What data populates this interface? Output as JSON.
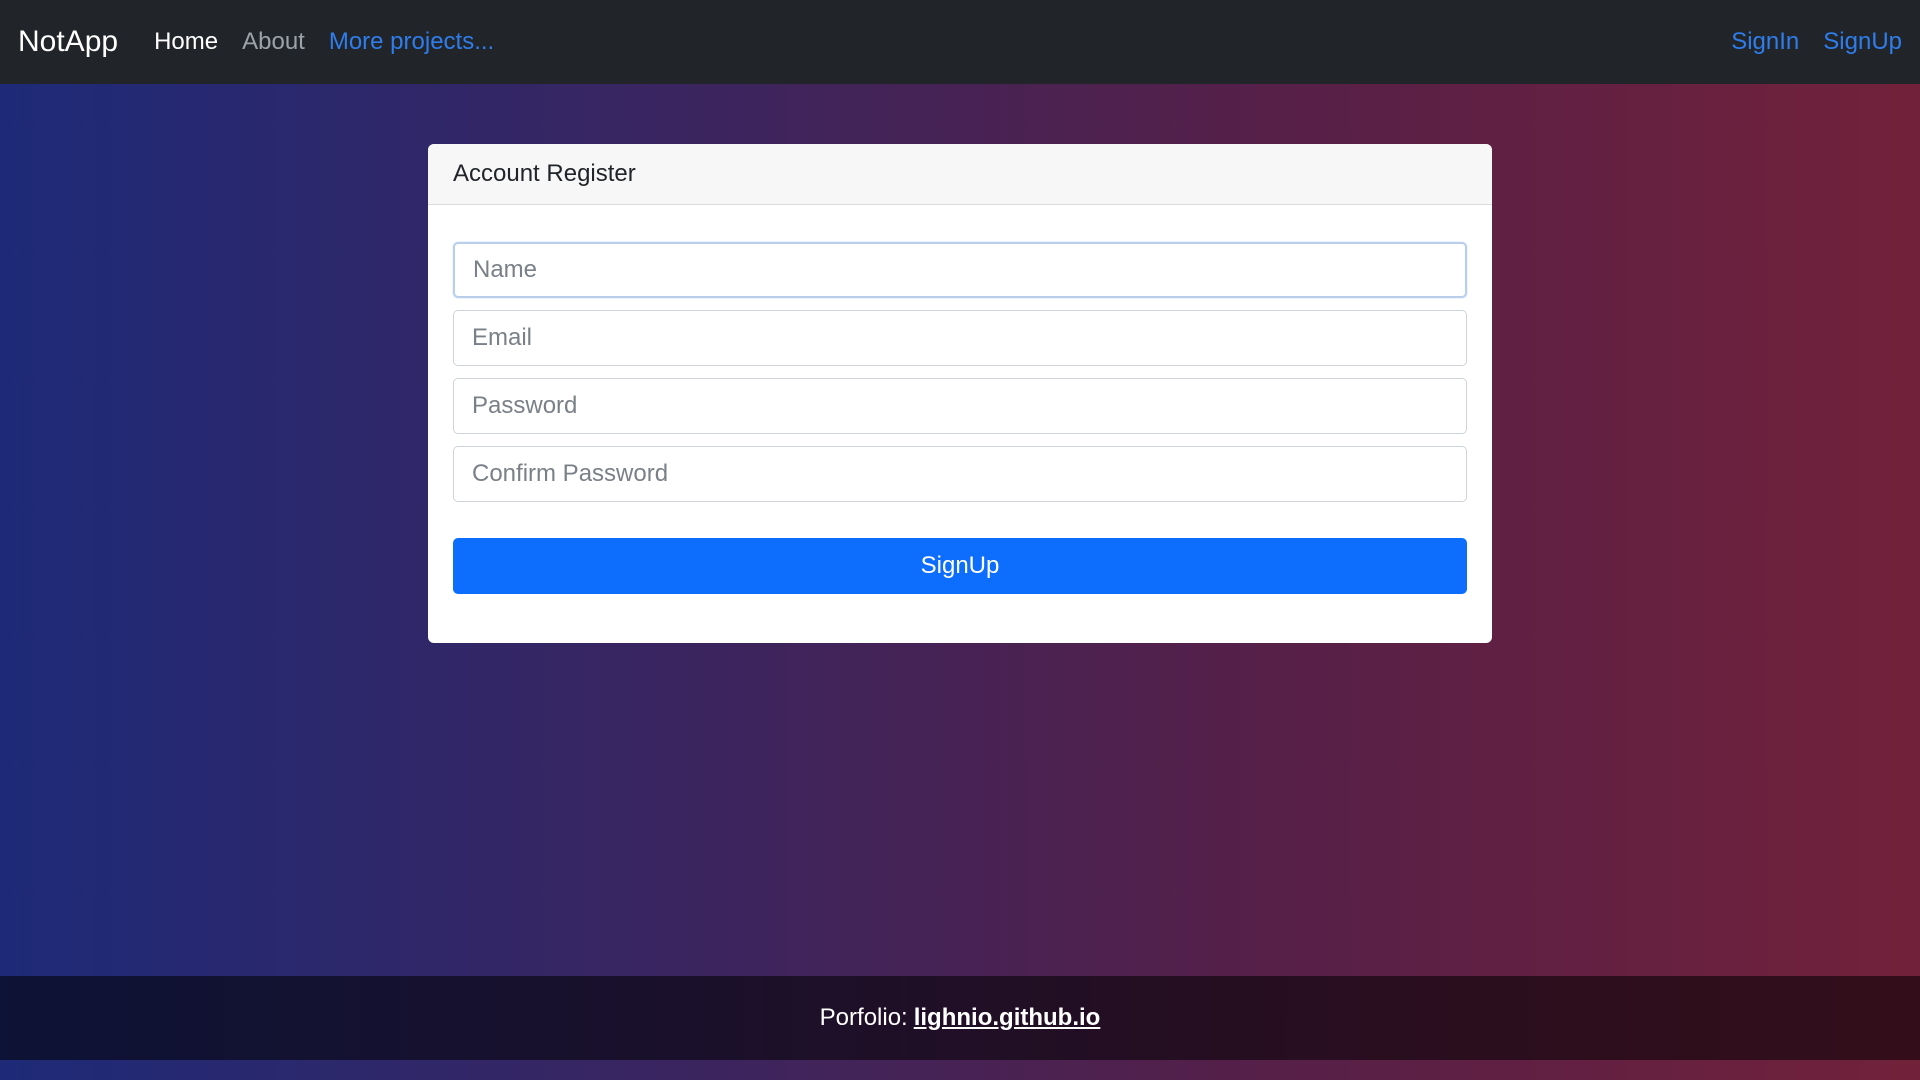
{
  "navbar": {
    "brand": "NotApp",
    "links": {
      "home": "Home",
      "about": "About",
      "more": "More projects..."
    },
    "auth": {
      "signin": "SignIn",
      "signup": "SignUp"
    },
    "colors": {
      "background": "#212529",
      "accent": "#2f7dea"
    }
  },
  "register_card": {
    "title": "Account Register",
    "fields": {
      "name": {
        "placeholder": "Name",
        "value": ""
      },
      "email": {
        "placeholder": "Email",
        "value": ""
      },
      "password": {
        "placeholder": "Password",
        "value": ""
      },
      "confirm_password": {
        "placeholder": "Confirm Password",
        "value": ""
      }
    },
    "submit_label": "SignUp",
    "submit_color": "#0d6efd"
  },
  "footer": {
    "prefix": "Porfolio:",
    "link_text": "lighnio.github.io"
  }
}
